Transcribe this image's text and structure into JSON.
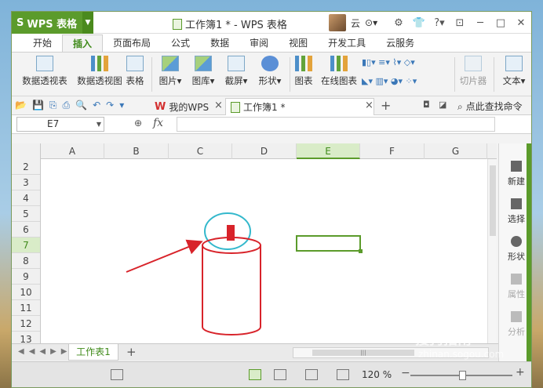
{
  "titlebar": {
    "app": "WPS 表格",
    "doc_title": "工作簿1 * - WPS 表格",
    "user": "云"
  },
  "menu_tabs": [
    "开始",
    "插入",
    "页面布局",
    "公式",
    "数据",
    "审阅",
    "视图",
    "开发工具",
    "云服务"
  ],
  "active_menu": "插入",
  "ribbon": {
    "pivot_table": "数据透视表",
    "pivot_chart": "数据透视图",
    "table": "表格",
    "picture": "图片",
    "gallery": "图库",
    "screenshot": "截屏",
    "shape": "形状",
    "chart": "图表",
    "online_chart": "在线图表",
    "slicer": "切片器",
    "text": "文本"
  },
  "doc_tabs": {
    "mywps": "我的WPS",
    "current": "工作簿1 *",
    "search_cmd": "点此查找命令"
  },
  "formula_bar": {
    "cell_ref": "E7",
    "fx": "fx",
    "formula": ""
  },
  "columns": [
    "A",
    "B",
    "C",
    "D",
    "E",
    "F",
    "G"
  ],
  "selected_column": "E",
  "rows": [
    "2",
    "3",
    "4",
    "5",
    "6",
    "7",
    "8",
    "9",
    "10",
    "11",
    "12",
    "13"
  ],
  "selected_row": "7",
  "task_pane": {
    "new": "新建",
    "select": "选择",
    "shape": "形状",
    "props": "属性",
    "analyze": "分析"
  },
  "sheets": [
    "工作表1"
  ],
  "status": {
    "zoom": "120 %"
  },
  "watermark": {
    "brand": "搜狗指南",
    "url": "zhinan.sogou.com"
  },
  "colors": {
    "accent": "#5b9b2b",
    "drawing": "#d8232a",
    "circle": "#33b8cc"
  }
}
